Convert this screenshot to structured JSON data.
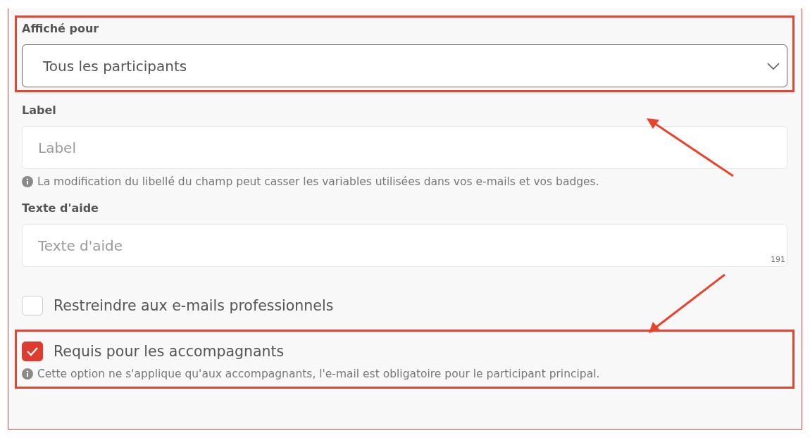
{
  "shown_for": {
    "label": "Affiché pour",
    "value": "Tous les participants",
    "highlighted": true
  },
  "fields": [
    {
      "label": "Label",
      "placeholder": "Label",
      "hint": "La modification du libellé du champ peut casser les variables utilisées dans vos e-mails et vos badges."
    },
    {
      "label": "Texte d'aide",
      "placeholder": "Texte d'aide",
      "counter": "191"
    }
  ],
  "options": [
    {
      "label": "Restreindre aux e-mails professionnels",
      "checked": false,
      "highlighted": false
    },
    {
      "label": "Requis pour les accompagnants",
      "checked": true,
      "highlighted": true,
      "hint": "Cette option ne s'applique qu'aux accompagnants, l'e-mail est obligatoire pour le participant principal."
    }
  ]
}
